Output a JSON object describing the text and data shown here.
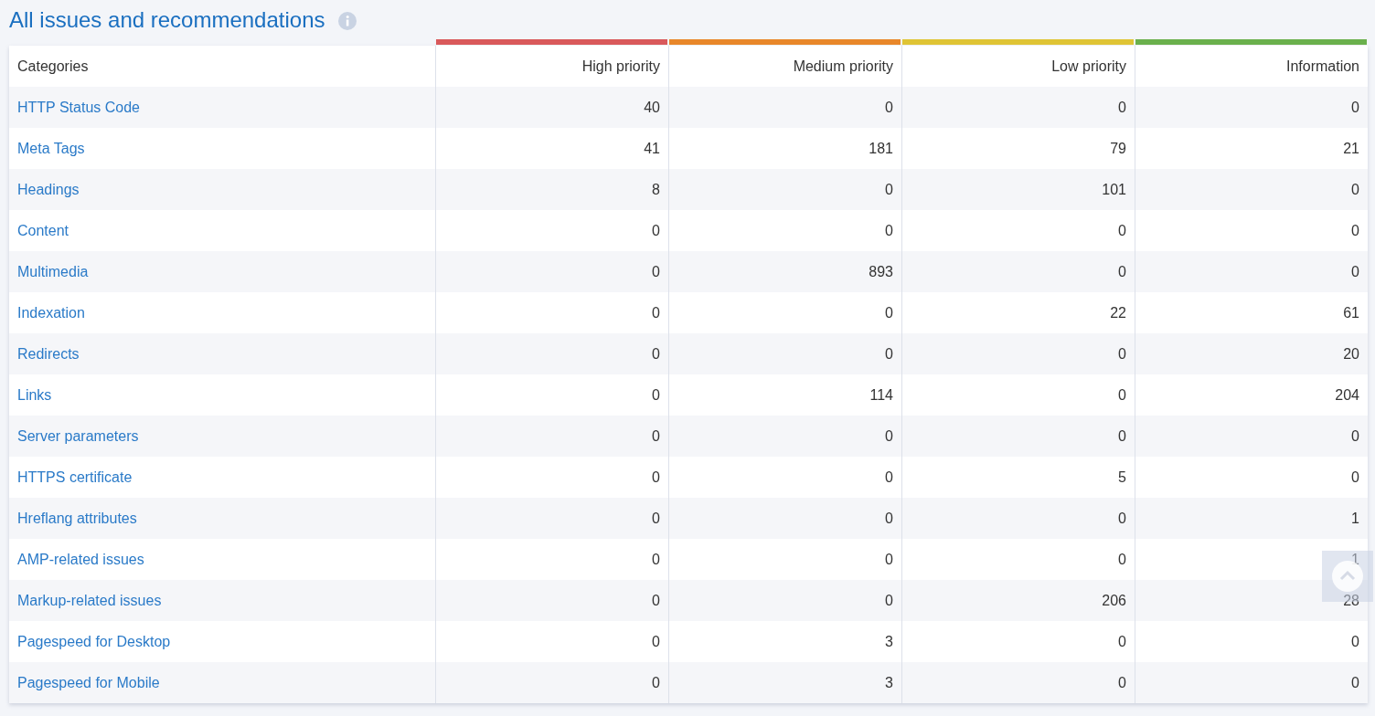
{
  "title": "All issues and recommendations",
  "table": {
    "category_column": "Categories",
    "columns": [
      {
        "label": "High priority",
        "color": "#d9595b"
      },
      {
        "label": "Medium priority",
        "color": "#e8872a"
      },
      {
        "label": "Low priority",
        "color": "#dfc435"
      },
      {
        "label": "Information",
        "color": "#6ab04c"
      }
    ],
    "rows": [
      {
        "category": "HTTP Status Code",
        "values": [
          "40",
          "0",
          "0",
          "0"
        ]
      },
      {
        "category": "Meta Tags",
        "values": [
          "41",
          "181",
          "79",
          "21"
        ]
      },
      {
        "category": "Headings",
        "values": [
          "8",
          "0",
          "101",
          "0"
        ]
      },
      {
        "category": "Content",
        "values": [
          "0",
          "0",
          "0",
          "0"
        ]
      },
      {
        "category": "Multimedia",
        "values": [
          "0",
          "893",
          "0",
          "0"
        ]
      },
      {
        "category": "Indexation",
        "values": [
          "0",
          "0",
          "22",
          "61"
        ]
      },
      {
        "category": "Redirects",
        "values": [
          "0",
          "0",
          "0",
          "20"
        ]
      },
      {
        "category": "Links",
        "values": [
          "0",
          "114",
          "0",
          "204"
        ]
      },
      {
        "category": "Server parameters",
        "values": [
          "0",
          "0",
          "0",
          "0"
        ]
      },
      {
        "category": "HTTPS certificate",
        "values": [
          "0",
          "0",
          "5",
          "0"
        ]
      },
      {
        "category": "Hreflang attributes",
        "values": [
          "0",
          "0",
          "0",
          "1"
        ]
      },
      {
        "category": "AMP-related issues",
        "values": [
          "0",
          "0",
          "0",
          "1"
        ]
      },
      {
        "category": "Markup-related issues",
        "values": [
          "0",
          "0",
          "206",
          "28"
        ]
      },
      {
        "category": "Pagespeed for Desktop",
        "values": [
          "0",
          "3",
          "0",
          "0"
        ]
      },
      {
        "category": "Pagespeed for Mobile",
        "values": [
          "0",
          "3",
          "0",
          "0"
        ]
      }
    ]
  }
}
